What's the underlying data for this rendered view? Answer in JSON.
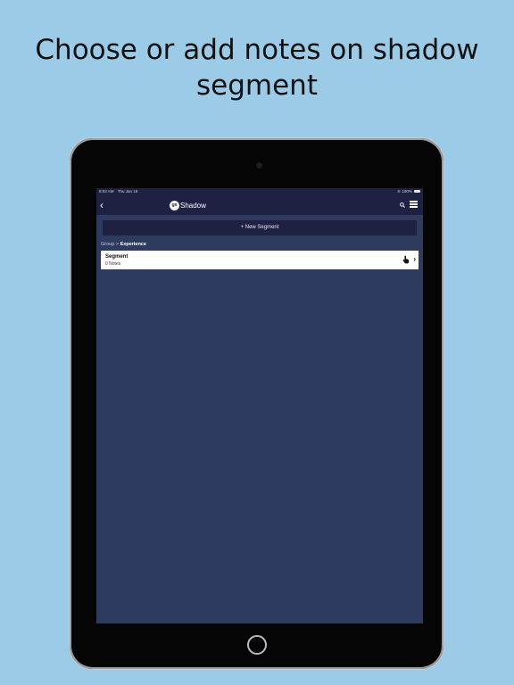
{
  "caption": {
    "line1": "Choose or add notes on shadow",
    "line2": "segment"
  },
  "status": {
    "time": "8:03 AM",
    "date": "Thu Jan 19",
    "battery": "100%"
  },
  "nav": {
    "logo_mark": "gs",
    "logo_text": "Shadow"
  },
  "toolbar": {
    "new_segment_label": "+ New Segment"
  },
  "breadcrumb": {
    "parent": "Group",
    "separator": ">",
    "current": "Experience"
  },
  "segments": [
    {
      "title": "Segment",
      "notes": "0 Notes"
    }
  ],
  "icons": {
    "back": "chevron-left-icon",
    "search": "search-icon",
    "menu": "hamburger-menu-icon",
    "hand": "hand-pointer-icon",
    "chevron": "chevron-right-icon"
  }
}
